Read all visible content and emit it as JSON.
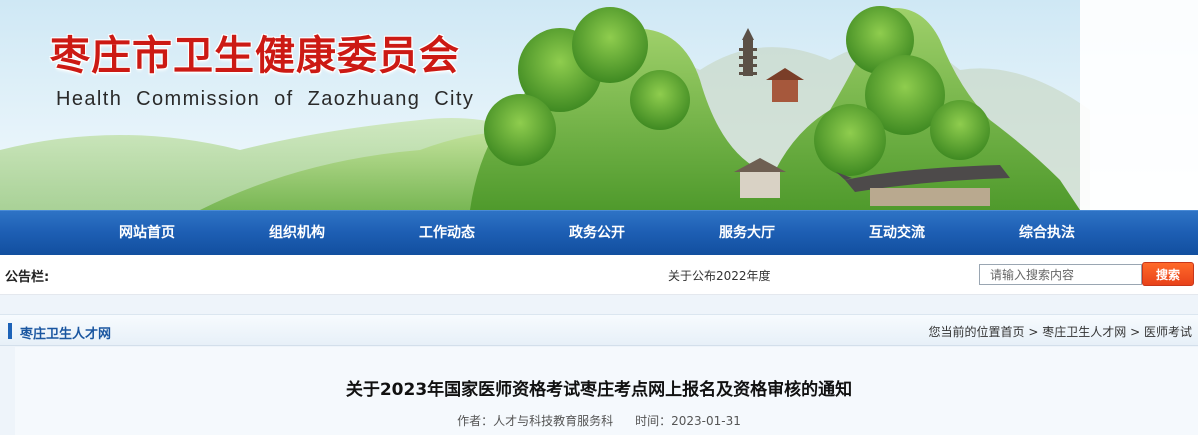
{
  "header": {
    "title": "枣庄市卫生健康委员会",
    "subtitle": "Health Commission of Zaozhuang City",
    "title_color": "#cc1a14"
  },
  "nav": {
    "items": [
      "网站首页",
      "组织机构",
      "工作动态",
      "政务公开",
      "服务大厅",
      "互动交流",
      "综合执法"
    ],
    "background_color": "#1d5eb3"
  },
  "notice": {
    "label": "公告栏:",
    "text": "关于公布2022年度"
  },
  "search": {
    "placeholder": "请输入搜索内容",
    "button_label": "搜索",
    "button_color": "#e8421a"
  },
  "section": {
    "title": "枣庄卫生人才网",
    "breadcrumb": {
      "prefix": "您当前的位置首页",
      "separator": ">",
      "items": [
        "枣庄卫生人才网",
        "医师考试"
      ]
    }
  },
  "article": {
    "title": "关于2023年国家医师资格考试枣庄考点网上报名及资格审核的通知",
    "author_label": "作者：",
    "author": "人才与科技教育服务科",
    "date_label": "时间：",
    "date": "2023-01-31"
  }
}
